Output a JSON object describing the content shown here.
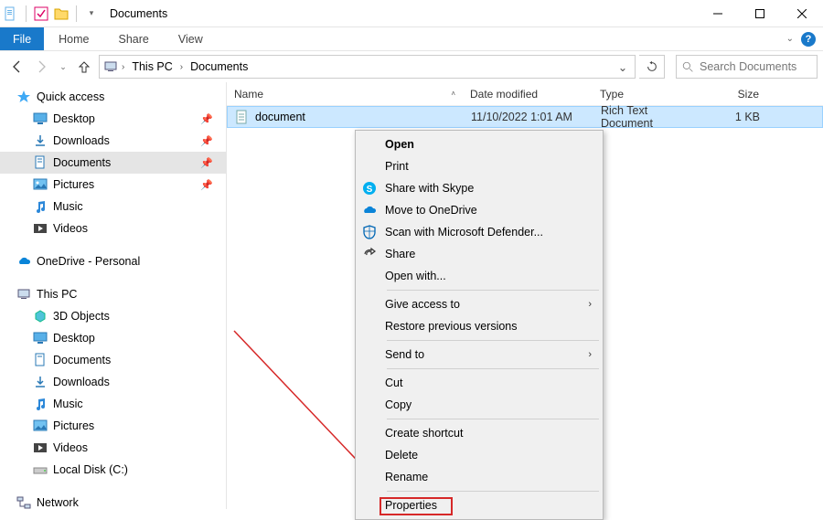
{
  "window": {
    "title": "Documents"
  },
  "ribbon": {
    "file": "File",
    "tabs": [
      "Home",
      "Share",
      "View"
    ]
  },
  "breadcrumb": {
    "segments": [
      "This PC",
      "Documents"
    ]
  },
  "search": {
    "placeholder": "Search Documents"
  },
  "nav": {
    "quickAccess": "Quick access",
    "qa_items": [
      {
        "label": "Desktop",
        "iconColor": "#3b8ee4"
      },
      {
        "label": "Downloads",
        "iconColor": "#3b8ee4"
      },
      {
        "label": "Documents",
        "iconColor": "#3b8ee4",
        "selected": true
      },
      {
        "label": "Pictures",
        "iconColor": "#3b8ee4"
      },
      {
        "label": "Music",
        "iconColor": "#2c88d9"
      },
      {
        "label": "Videos",
        "iconColor": "#2c88d9"
      }
    ],
    "onedrive": "OneDrive - Personal",
    "thisPC": "This PC",
    "pc_items": [
      {
        "label": "3D Objects"
      },
      {
        "label": "Desktop"
      },
      {
        "label": "Documents"
      },
      {
        "label": "Downloads"
      },
      {
        "label": "Music"
      },
      {
        "label": "Pictures"
      },
      {
        "label": "Videos"
      },
      {
        "label": "Local Disk (C:)"
      }
    ],
    "network": "Network"
  },
  "columns": {
    "name": "Name",
    "date": "Date modified",
    "type": "Type",
    "size": "Size"
  },
  "rows": [
    {
      "name": "document",
      "date": "11/10/2022 1:01 AM",
      "type": "Rich Text Document",
      "size": "1 KB"
    }
  ],
  "context_menu": {
    "open": "Open",
    "print": "Print",
    "skype": "Share with Skype",
    "onedrive": "Move to OneDrive",
    "defender": "Scan with Microsoft Defender...",
    "share": "Share",
    "openwith": "Open with...",
    "giveaccess": "Give access to",
    "restore": "Restore previous versions",
    "sendto": "Send to",
    "cut": "Cut",
    "copy": "Copy",
    "shortcut": "Create shortcut",
    "delete": "Delete",
    "rename": "Rename",
    "properties": "Properties"
  }
}
